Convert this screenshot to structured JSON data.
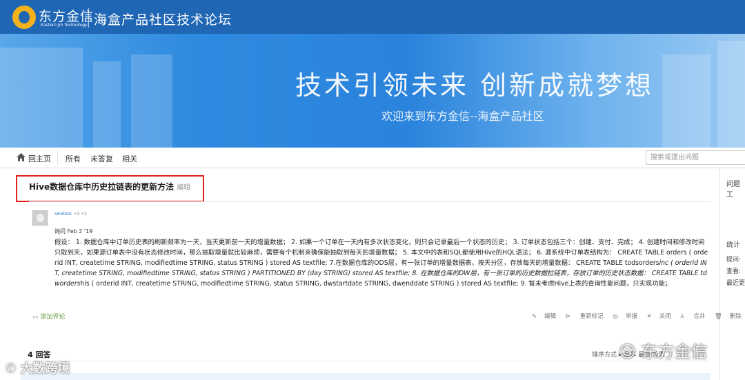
{
  "header": {
    "logo_cn": "东方金信",
    "logo_en": "Eastern Jin Technology",
    "site_title": "海盒产品社区技术论坛"
  },
  "banner": {
    "title": "技术引领未来   创新成就梦想",
    "subtitle": "欢迎来到东方金信--海盒产品社区"
  },
  "nav": {
    "home": "回主页",
    "all": "所有",
    "unanswered": "未答复",
    "related": "相关",
    "search_placeholder": "搜索或提出问题"
  },
  "sidebar": {
    "tools": "问题工",
    "stats": "统计",
    "asked": "提问:",
    "viewed": "查看:",
    "recent": "最近更"
  },
  "question": {
    "title": "Hive数据仓库中历史拉链表的更新方法",
    "edit": "编辑",
    "user": "seabox",
    "user_stats": "•3 •2",
    "asked_at": "询问 Feb 2 '19",
    "body_p1": "假设：  1. 数据仓库中订单历史表的刷新频率为一天，当天更新前一天的增量数据；  2. 如果一个订单在一天内有多次状态变化，则只会记录最后一个状态的历史；  3. 订单状态包括三个：创建、支付、完成；  4. 创建时间和修改时间只取到天，如果源订单表中没有状态修改时间，那么抽取增量就比较麻烦，需要有个机制来确保能抽取到每天的增量数据；  5. 本文中的表和SQL都使用Hive的HQL语法；  6. 源系统中订单表结构为：  CREATE TABLE orders ( orderid INT, createtime STRING, modifiedtime STRING, status STRING ) stored AS textfile;  7.在数据仓库的ODS层，有一张订单的增量数据表，按天分区，存放每天的增量数据：  CREATE TABLE todsorders",
    "body_italic": "inc ( orderid INT, createtime STRING, modifiedtime STRING, status STRING ) PARTITIONED BY (day STRING) stored AS textfile; 8. 在数据仓库的DW层，有一张订单的历史数据拉链表，存放订单的历史状态数据：  CREATE TABLE tdworders",
    "body_p2": "his ( orderid INT, createtime STRING, modifiedtime STRING, status STRING, dwstartdate STRING, dwenddate STRING ) stored AS textfile;  9. 暂未考虑Hive上表的查询性能问题，只实现功能；"
  },
  "actions": {
    "add_comment": "添加评论",
    "edit": "编辑",
    "retag": "重新标记",
    "report": "举报",
    "close": "关闭",
    "merge": "合并",
    "delete": "删除"
  },
  "answers": {
    "count": "4 回答",
    "sort_label": "排序方式 ▸ 最早 最新 投票"
  },
  "watermarks": {
    "left": "大数跨境",
    "right": "东方金信"
  }
}
